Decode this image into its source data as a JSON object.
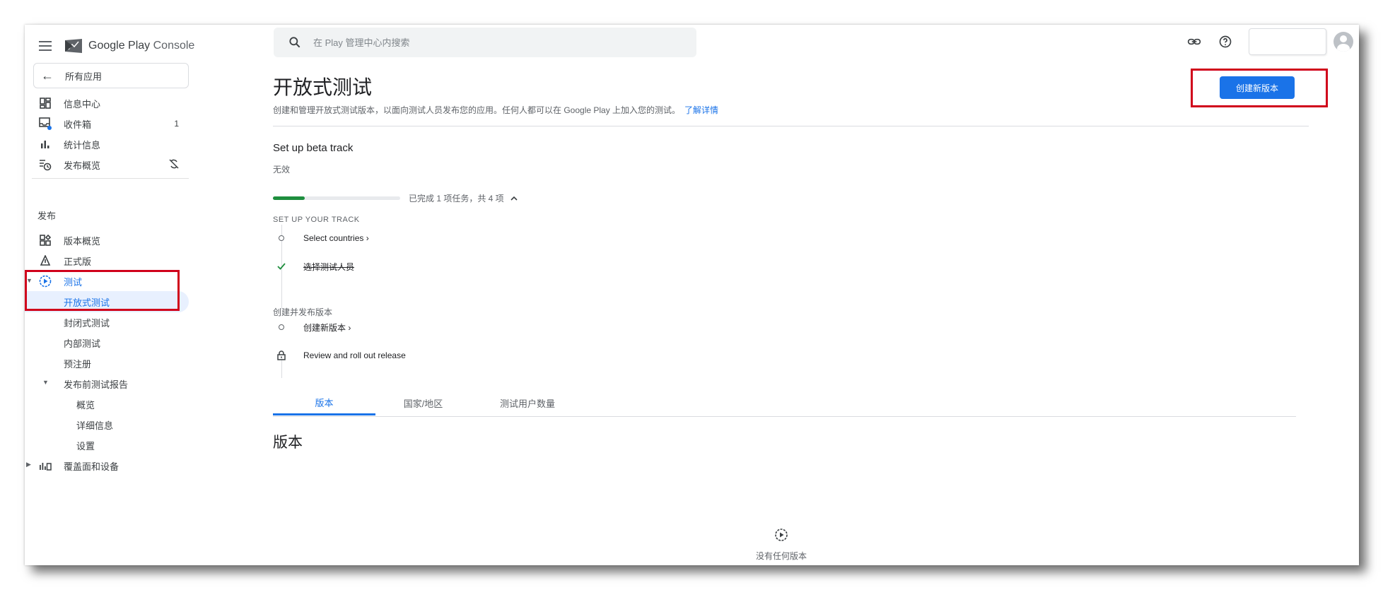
{
  "app": {
    "logo_text": "Google Play",
    "logo_console": "Console"
  },
  "search": {
    "placeholder": "在 Play 管理中心内搜索"
  },
  "sidebar": {
    "all_apps": "所有应用",
    "items": [
      {
        "label": "信息中心"
      },
      {
        "label": "收件箱",
        "badge": "1"
      },
      {
        "label": "统计信息"
      },
      {
        "label": "发布概览"
      }
    ],
    "publish_section": "发布",
    "publish_items": [
      {
        "label": "版本概览"
      },
      {
        "label": "正式版"
      },
      {
        "label": "测试"
      },
      {
        "label": "开放式测试"
      },
      {
        "label": "封闭式测试"
      },
      {
        "label": "内部测试"
      },
      {
        "label": "预注册"
      },
      {
        "label": "发布前测试报告"
      },
      {
        "label": "概览"
      },
      {
        "label": "详细信息"
      },
      {
        "label": "设置"
      },
      {
        "label": "覆盖面和设备"
      }
    ]
  },
  "main": {
    "title": "开放式测试",
    "description": "创建和管理开放式测试版本，以面向测试人员发布您的应用。任何人都可以在 Google Play 上加入您的测试。",
    "learn_more": "了解详情",
    "create_button": "创建新版本",
    "beta_track": {
      "title": "Set up beta track",
      "status": "无效",
      "progress_fraction": 0.25,
      "progress_text": "已完成 1 项任务，共 4 项",
      "heading": "SET UP YOUR TRACK",
      "steps": [
        {
          "label": "Select countries ›"
        },
        {
          "label": "选择测试人员"
        }
      ],
      "release_heading": "创建并发布版本",
      "release_steps": [
        {
          "label": "创建新版本 ›"
        },
        {
          "label": "Review and roll out release"
        }
      ]
    },
    "tabs": [
      {
        "label": "版本"
      },
      {
        "label": "国家/地区"
      },
      {
        "label": "测试用户数量"
      }
    ],
    "section_title": "版本",
    "empty_text": "没有任何版本"
  },
  "colors": {
    "accent": "#1a73e8",
    "success": "#1e8e3e",
    "highlight": "#d0021b"
  }
}
